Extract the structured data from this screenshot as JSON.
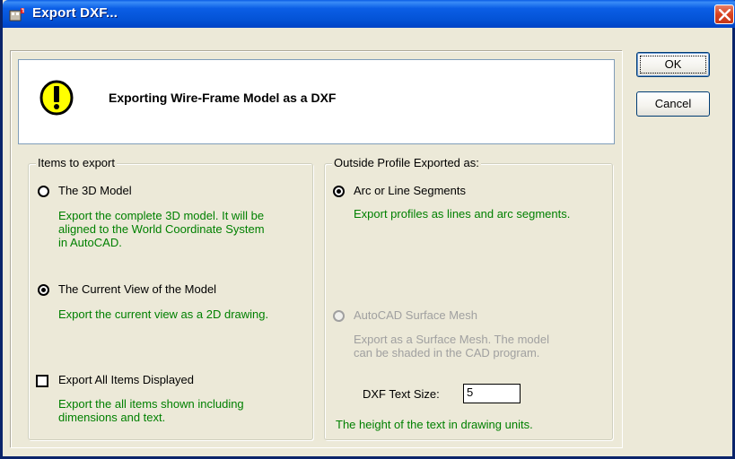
{
  "window": {
    "title": "Export DXF...",
    "close_label": "×"
  },
  "header": {
    "icon": "warning-exclamation-icon",
    "text": "Exporting Wire-Frame Model as a DXF"
  },
  "buttons": {
    "ok": "OK",
    "cancel": "Cancel"
  },
  "items_to_export": {
    "legend": "Items to export",
    "options": [
      {
        "label": "The 3D Model",
        "selected": false,
        "description": [
          "Export the complete 3D model. It will be",
          "aligned to the World Coordinate System",
          "in AutoCAD."
        ]
      },
      {
        "label": "The Current View of the Model",
        "selected": true,
        "description": [
          "Export the current view as a 2D drawing."
        ]
      }
    ],
    "checkbox": {
      "label": "Export All Items Displayed",
      "checked": false,
      "description": [
        "Export the all items shown including",
        "dimensions and text."
      ]
    }
  },
  "outside_profile": {
    "legend": "Outside Profile Exported as:",
    "options": [
      {
        "label": "Arc or Line Segments",
        "selected": true,
        "enabled": true,
        "description": [
          "Export profiles as lines and arc segments."
        ]
      },
      {
        "label": "AutoCAD Surface Mesh",
        "selected": false,
        "enabled": false,
        "description": [
          "Export as a Surface Mesh. The model",
          "can be shaded in the CAD program."
        ]
      }
    ],
    "text_size": {
      "label": "DXF Text Size:",
      "value": "5",
      "description": "The height of the text in drawing units."
    }
  },
  "colors": {
    "title_bar": "#0453d6",
    "description_text": "#008000",
    "disabled_text": "#a0a0a0",
    "close_button": "#d9421f"
  }
}
